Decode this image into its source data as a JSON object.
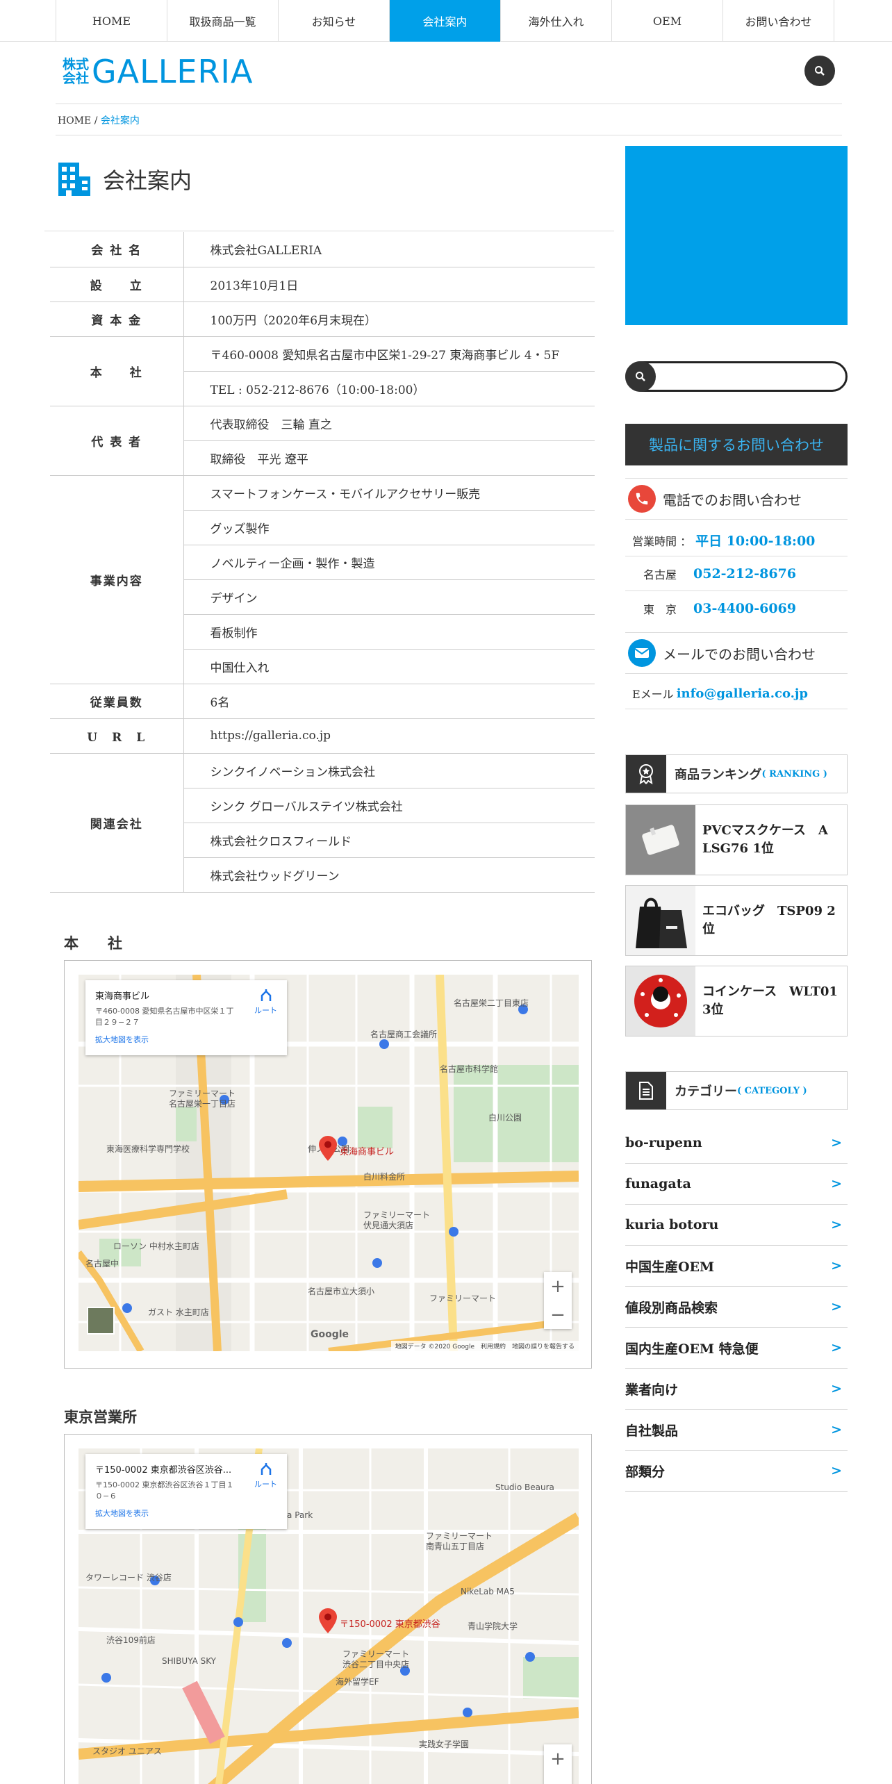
{
  "nav": {
    "items": [
      "HOME",
      "取扱商品一覧",
      "お知らせ",
      "会社案内",
      "海外仕入れ",
      "OEM",
      "お問い合わせ"
    ],
    "active_index": 3
  },
  "header": {
    "logo_kabu_top": "株式",
    "logo_kabu_bottom": "会社",
    "logo_name": "GALLERIA"
  },
  "breadcrumb": {
    "home": "HOME",
    "sep": "/",
    "current": "会社案内"
  },
  "page_title": "会社案内",
  "company": {
    "name_label": "会 社 名",
    "name": "株式会社GALLERIA",
    "founded_label": "設　　立",
    "founded": "2013年10月1日",
    "capital_label": "資 本 金",
    "capital": "100万円（2020年6月末現在）",
    "hq_label": "本　　社",
    "hq_address": "〒460-0008 愛知県名古屋市中区栄1-29-27 東海商事ビル 4・5F",
    "hq_tel": "TEL : 052-212-8676（10:00-18:00）",
    "rep_label": "代 表 者",
    "rep1": "代表取締役　三輪 直之",
    "rep2": "取締役　平光 遼平",
    "biz_label": "事業内容",
    "biz": [
      "スマートフォンケース・モバイルアクセサリー販売",
      "グッズ製作",
      "ノベルティー企画・製作・製造",
      "デザイン",
      "看板制作",
      "中国仕入れ"
    ],
    "emp_label": "従業員数",
    "employees": "6名",
    "url_label": "U　R　L",
    "url": "https://galleria.co.jp",
    "rel_label": "関連会社",
    "related": [
      "シンクイノベーション株式会社",
      "シンク グローバルステイツ株式会社",
      "株式会社クロスフィールド",
      "株式会社ウッドグリーン"
    ]
  },
  "maps": {
    "hq_title": "本　　社",
    "hq": {
      "info_title": "東海商事ビル",
      "info_addr": "〒460-0008 愛知県名古屋市中区栄１丁目２９−２７",
      "info_link": "拡大地図を表示",
      "route": "ルート",
      "marker_label": "東海商事ビル",
      "attrib": "地図データ ©2020 Google　利用規約　地図の誤りを報告する",
      "google": "Google"
    },
    "tokyo_title": "東京営業所",
    "tokyo": {
      "info_title": "〒150-0002 東京都渋谷区渋谷...",
      "info_addr": "〒150-0002 東京都渋谷区渋谷１丁目１０−６",
      "info_link": "拡大地図を表示",
      "route": "ルート",
      "marker_label": "〒150-0002 東京都渋谷"
    },
    "zoom_in": "+",
    "zoom_out": "−"
  },
  "sidebar": {
    "contact_button": "製品に関するお問い合わせ",
    "phone_head": "電話でのお問い合わせ",
    "hours_label": "営業時間 ：",
    "hours_value": "平日 10:00-18:00",
    "nagoya_label": "名古屋",
    "nagoya_tel": "052-212-8676",
    "tokyo_label": "東　京",
    "tokyo_tel": "03-4400-6069",
    "mail_head": "メールでのお問い合わせ",
    "email_label": "Eメール",
    "email": "info@galleria.co.jp",
    "ranking_head": "商品ランキング",
    "ranking_sub": "( RANKING )",
    "ranking": [
      {
        "name": "PVCマスクケース　A LSG76 1位"
      },
      {
        "name": "エコバッグ　TSP09 2位"
      },
      {
        "name": "コインケース　WLT01 3位"
      }
    ],
    "category_head": "カテゴリー",
    "category_sub": "( CATEGOLY )",
    "categories": [
      "bo-rupenn",
      "funagata",
      "kuria botoru",
      "中国生産OEM",
      "値段別商品検索",
      "国内生産OEM 特急便",
      "業者向け",
      "自社製品",
      "部類分"
    ],
    "arrow": ">"
  },
  "colors": {
    "accent": "#00a0e9",
    "dark": "#333333",
    "phone_red": "#e8473a",
    "mail_blue": "#0095df"
  }
}
